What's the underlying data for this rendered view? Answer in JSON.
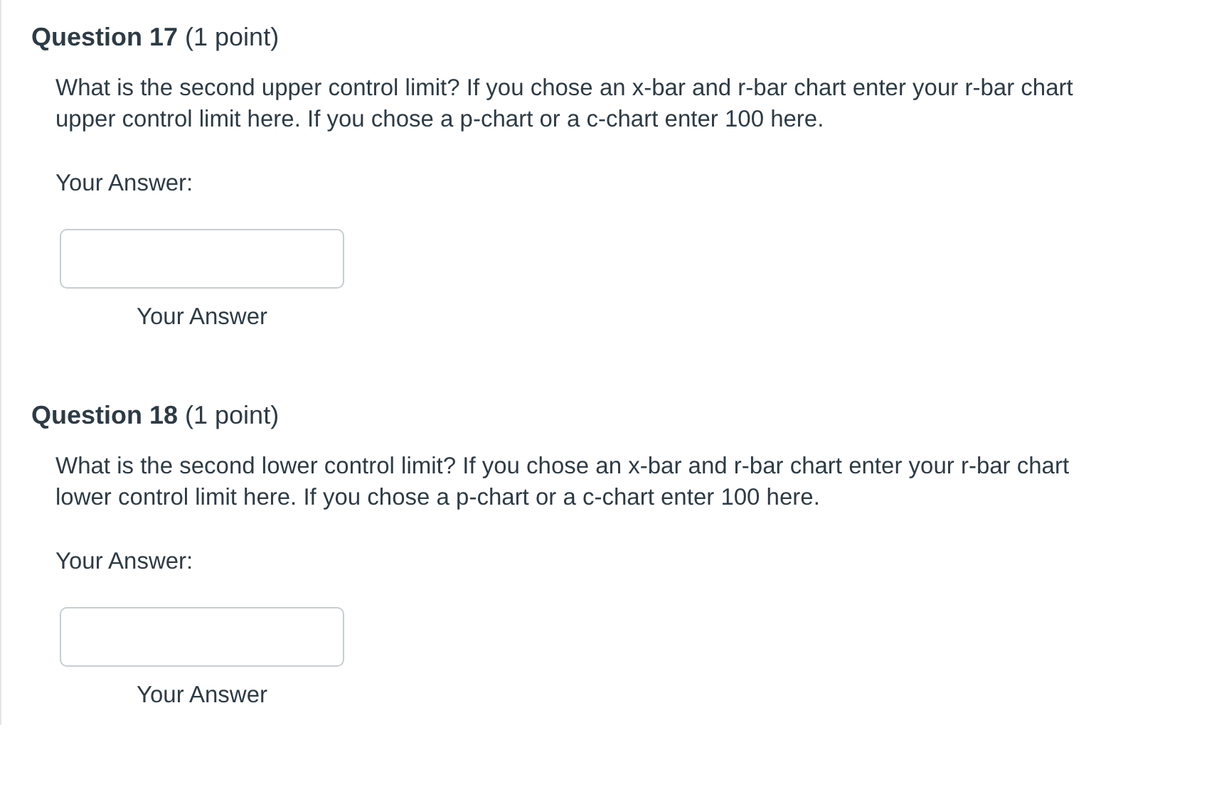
{
  "questions": [
    {
      "heading": "**Question 17** (1 point)",
      "prompt": "What is the second upper control limit?  If you chose an x-bar and r-bar chart enter your r-bar chart upper control limit here. If you chose a p-chart or a c-chart enter 100 here.",
      "answer_label": "Your Answer:",
      "field_label": "Your Answer"
    },
    {
      "heading": "**Question 18** (1 point)",
      "prompt": "What is the second lower control limit?  If you chose an x-bar and r-bar chart enter your r-bar chart lower control limit here. If you chose a p-chart or a c-chart enter 100 here.",
      "answer_label": "Your Answer:",
      "field_label": "Your Answer"
    }
  ]
}
